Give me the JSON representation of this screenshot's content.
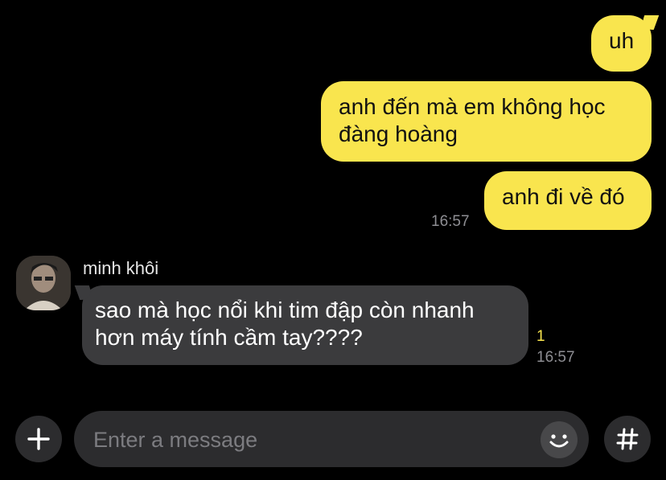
{
  "conversation": {
    "outgoing": [
      {
        "text": "uh"
      },
      {
        "text": "anh đến mà em không học đàng hoàng"
      },
      {
        "text": "anh đi về đó",
        "time": "16:57"
      }
    ],
    "incoming": [
      {
        "sender": "minh khôi",
        "text": "sao mà học nổi khi tim đập còn nhanh hơn máy tính cầm tay????",
        "unread_count": "1",
        "time": "16:57"
      }
    ]
  },
  "composer": {
    "placeholder": "Enter a message",
    "add_icon": "plus-icon",
    "emoji_icon": "emoji-icon",
    "hashtag_icon": "hashtag-icon"
  },
  "colors": {
    "background": "#000000",
    "outgoing_bubble": "#f9e54e",
    "incoming_bubble": "#3b3b3d",
    "accent": "#f9e54e"
  }
}
